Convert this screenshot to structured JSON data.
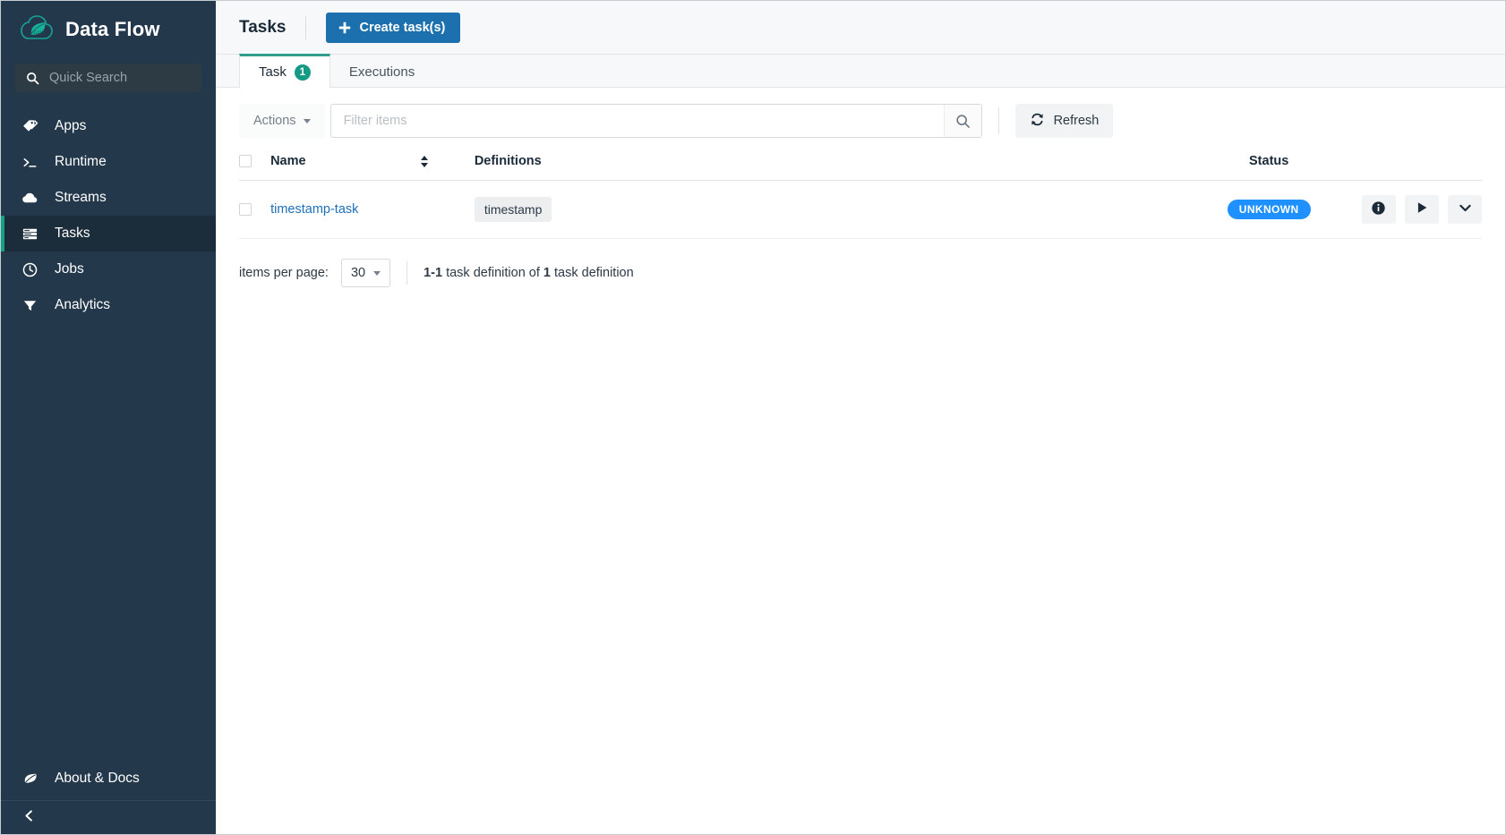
{
  "sidebar": {
    "brand": {
      "title": "Data Flow",
      "logo_icon": "spring-leaf-cloud-logo"
    },
    "quick_search": {
      "placeholder": "Quick Search",
      "icon": "search-icon"
    },
    "items": [
      {
        "label": "Apps",
        "icon": "tag-icon",
        "active": false
      },
      {
        "label": "Runtime",
        "icon": "terminal-prompt-icon",
        "active": false
      },
      {
        "label": "Streams",
        "icon": "cloud-icon",
        "active": false
      },
      {
        "label": "Tasks",
        "icon": "tasks-stack-icon",
        "active": true
      },
      {
        "label": "Jobs",
        "icon": "clock-icon",
        "active": false
      },
      {
        "label": "Analytics",
        "icon": "funnel-icon",
        "active": false
      }
    ],
    "about": {
      "label": "About & Docs",
      "icon": "leaf-icon"
    },
    "collapse": {
      "icon": "chevron-left-icon"
    }
  },
  "header": {
    "title": "Tasks",
    "create_button": {
      "label": "Create task(s)",
      "icon": "plus-icon"
    }
  },
  "tabs": [
    {
      "label": "Task",
      "badge": "1",
      "active": true
    },
    {
      "label": "Executions",
      "badge": null,
      "active": false
    }
  ],
  "toolbar": {
    "actions_label": "Actions",
    "filter_placeholder": "Filter items",
    "filter_value": "",
    "search_icon": "search-icon",
    "refresh_label": "Refresh",
    "refresh_icon": "refresh-icon"
  },
  "table": {
    "columns": [
      "Name",
      "Definitions",
      "Status"
    ],
    "rows": [
      {
        "name": "timestamp-task",
        "definition": "timestamp",
        "status": "UNKNOWN",
        "actions": [
          {
            "icon": "info-icon"
          },
          {
            "icon": "play-icon"
          },
          {
            "icon": "chevron-down-icon"
          }
        ]
      }
    ]
  },
  "pagination": {
    "items_per_page_label": "items per page:",
    "page_size": "30",
    "summary_range": "1-1",
    "summary_middle": " task definition of ",
    "summary_total": "1",
    "summary_tail": " task definition"
  },
  "colors": {
    "sidebar_bg": "#23384b",
    "accent_teal": "#16a085",
    "primary_blue": "#1d70ae",
    "status_blue": "#1e90ff",
    "link_blue": "#1d6fb8"
  }
}
